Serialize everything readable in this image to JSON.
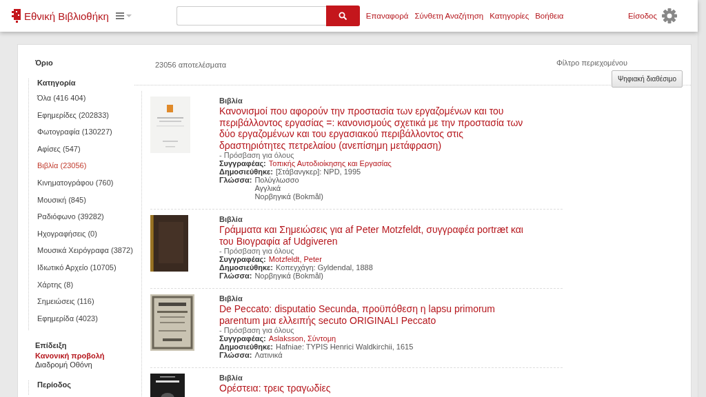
{
  "header": {
    "logo": "Εθνική Βιβλιοθήκη",
    "search": {
      "kind": "field"
    },
    "nav": [
      "Επαναφορά",
      "Σύνθετη Αναζήτηση",
      "Κατηγορίες",
      "Βοήθεια"
    ],
    "login": "Είσοδος"
  },
  "sidebar": {
    "title": "Όριο",
    "sections": [
      {
        "heading": "Κατηγορία",
        "kind": "list",
        "items": [
          {
            "label": "Όλα (416 404)",
            "selected": false
          },
          {
            "label": "Εφημερίδες (202833)",
            "selected": false
          },
          {
            "label": "Φωτογραφία (130227)",
            "selected": false
          },
          {
            "label": "Αφίσες (547)",
            "selected": false
          },
          {
            "label": "Βιβλία (23056)",
            "selected": true
          },
          {
            "label": "Κινηματογράφου (760)",
            "selected": false
          },
          {
            "label": "Μουσική (845)",
            "selected": false
          },
          {
            "label": "Ραδιόφωνο (39282)",
            "selected": false
          },
          {
            "label": "Ηχογραφήσεις (0)",
            "selected": false
          },
          {
            "label": "Μουσικά Χειρόγραφα (3872)",
            "selected": false
          },
          {
            "label": "Ιδιωτικό Αρχείο (10705)",
            "selected": false
          },
          {
            "label": "Χάρτης (8)",
            "selected": false
          },
          {
            "label": "Σημειώσεις (116)",
            "selected": false
          },
          {
            "label": "Εφημερίδα (4023)",
            "selected": false
          }
        ]
      },
      {
        "heading": "Επίδειξη",
        "kind": "compact",
        "items": [
          {
            "label": "Κανονική προβολή",
            "selected": true
          },
          {
            "label": "Διαδρομή Οθόνη",
            "selected": false
          }
        ]
      },
      {
        "heading": "Περίοδος",
        "kind": "list"
      }
    ]
  },
  "results": {
    "count": "23056 αποτελέσματα",
    "filter_label": "Φίλτρο περιεχομένου",
    "filter_button": "Ψηφιακή διαθέσιμο",
    "items": [
      {
        "category": "Βιβλία",
        "title": "Κανονισμοί που αφορούν την προστασία των εργαζομένων και του περιβάλλοντος εργασίας =: κανονισμούς σχετικά με την προστασία των δύο εργαζομένων και του εργασιακού περιβάλλοντος στις δραστηριότητες πετρελαίου (ανεπίσημη μετάφραση)",
        "access": "- Πρόσβαση για όλους",
        "fields": [
          {
            "label": "Συγγραφέας:",
            "kind": "link",
            "values": [
              "Τοπικής Αυτοδιοίκησης και Εργασίας"
            ]
          },
          {
            "label": "Δημοσιεύθηκε:",
            "kind": "text",
            "values": [
              "[Στάβανγκερ]: NPD, 1995"
            ]
          },
          {
            "label": "Γλώσσα:",
            "kind": "text",
            "values": [
              "Πολύγλωσσο",
              "Αγγλικά",
              "Νορβηγικά (Bokmål)"
            ]
          }
        ]
      },
      {
        "category": "Βιβλία",
        "title": "Γράμματα και Σημειώσεις για af Peter Motzfeldt, συγγραφέα portræt και του Βιογραφία af Udgiveren",
        "access": "- Πρόσβαση για όλους",
        "fields": [
          {
            "label": "Συγγραφέας:",
            "kind": "link",
            "values": [
              "Motzfeldt, Peter"
            ]
          },
          {
            "label": "Δημοσιεύθηκε:",
            "kind": "text",
            "values": [
              "Κοπεγχάγη: Gyldendal, 1888"
            ]
          },
          {
            "label": "Γλώσσα:",
            "kind": "text",
            "values": [
              "Νορβηγικά (Bokmål)"
            ]
          }
        ]
      },
      {
        "category": "Βιβλία",
        "title": "De Peccato: disputatio Secunda, προϋπόθεση η lapsu primorum parentum μια ελλειπής secuto ORIGINALI Peccato",
        "access": "- Πρόσβαση για όλους",
        "fields": [
          {
            "label": "Συγγραφέας:",
            "kind": "link",
            "values": [
              "Aslaksson, Σύντομη"
            ]
          },
          {
            "label": "Δημοσιεύθηκε:",
            "kind": "text",
            "values": [
              "Hafniae: TYPIS Henrici Waldkirchii, 1615"
            ]
          },
          {
            "label": "Γλώσσα:",
            "kind": "text",
            "values": [
              "Λατινικά"
            ]
          }
        ]
      },
      {
        "category": "Βιβλία",
        "title": "Ορέστεια: τρεις τραγωδίες"
      }
    ]
  }
}
